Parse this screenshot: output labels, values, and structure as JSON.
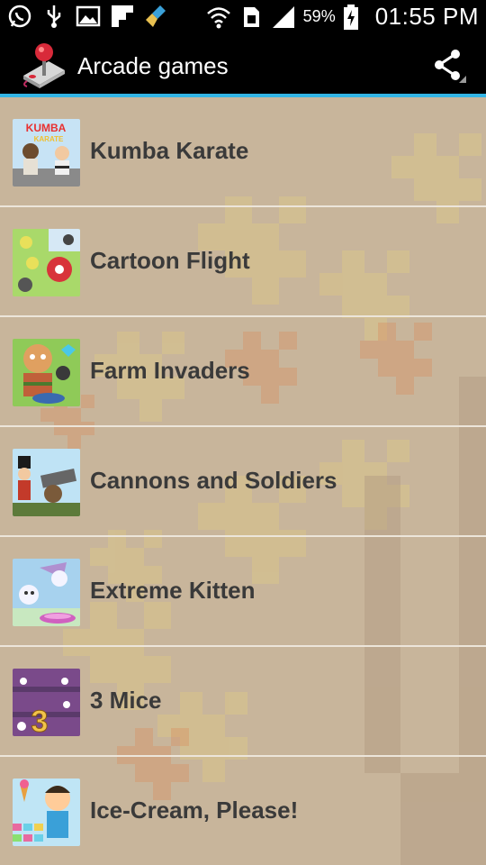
{
  "status_bar": {
    "battery_percent": "59%",
    "time": "01:55 PM",
    "icons": [
      "whatsapp-icon",
      "usb-icon",
      "gallery-icon",
      "flipboard-icon",
      "cleaner-icon",
      "wifi-icon",
      "sim-icon",
      "signal-icon",
      "battery-icon"
    ]
  },
  "action_bar": {
    "title": "Arcade games",
    "app_icon": "joystick-icon",
    "share_icon": "share-icon"
  },
  "games": [
    {
      "name": "Kumba Karate",
      "thumb_colors": [
        "#c7e3f5",
        "#6d4c2e",
        "#d9d4c8"
      ]
    },
    {
      "name": "Cartoon Flight",
      "thumb_colors": [
        "#a9d96a",
        "#e8e05a",
        "#d8343a"
      ]
    },
    {
      "name": "Farm Invaders",
      "thumb_colors": [
        "#8fca58",
        "#e0a060",
        "#4a7a2e"
      ]
    },
    {
      "name": "Cannons and Soldiers",
      "thumb_colors": [
        "#bfe3f5",
        "#5d7a3a",
        "#c33a2a"
      ]
    },
    {
      "name": "Extreme Kitten",
      "thumb_colors": [
        "#a7d2ee",
        "#ffffff",
        "#d060c0"
      ]
    },
    {
      "name": "3 Mice",
      "thumb_colors": [
        "#7a4a8a",
        "#f2c34a",
        "#ffffff"
      ]
    },
    {
      "name": "Ice-Cream, Please!",
      "thumb_colors": [
        "#bfe5f5",
        "#ffcc99",
        "#3aa0d8"
      ]
    }
  ],
  "colors": {
    "action_bar_bg": "#000000",
    "accent_line": "#33b5e5",
    "list_bg": "#c8b59b",
    "divider": "#ece5da",
    "text": "#3a3a3a"
  }
}
